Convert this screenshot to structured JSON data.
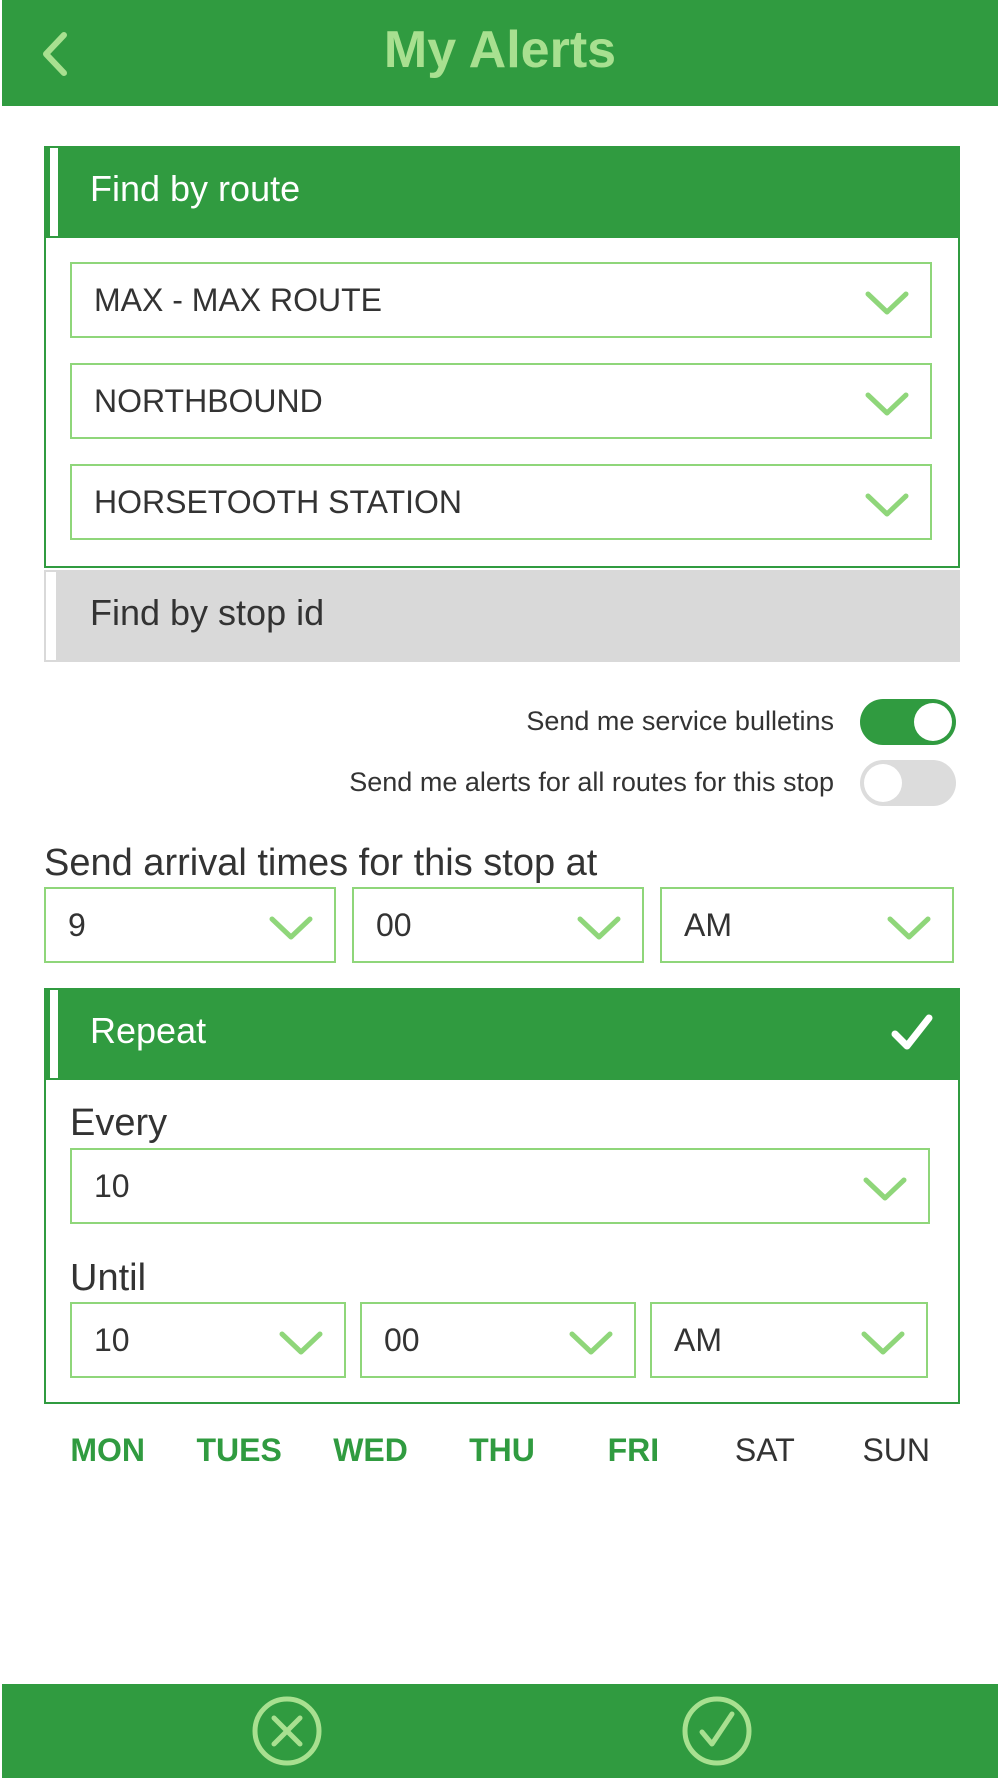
{
  "header": {
    "title": "My Alerts",
    "back_icon": "chevron-left-icon"
  },
  "route_panel": {
    "title": "Find by route",
    "route": "MAX - MAX ROUTE",
    "direction": "NORTHBOUND",
    "stop": "HORSETOOTH STATION"
  },
  "stop_id_panel": {
    "title": "Find by stop id"
  },
  "toggles": {
    "service_bulletins": {
      "label": "Send me service bulletins",
      "state": "on"
    },
    "all_routes": {
      "label": "Send me alerts for all routes for this stop",
      "state": "off"
    }
  },
  "arrival": {
    "label": "Send arrival times for this stop at",
    "hour": "9",
    "minute": "00",
    "ampm": "AM"
  },
  "repeat": {
    "title": "Repeat",
    "checked": true,
    "every_label": "Every",
    "every_value": "10",
    "until_label": "Until",
    "until_hour": "10",
    "until_minute": "00",
    "until_ampm": "AM"
  },
  "days": [
    {
      "label": "MON",
      "active": true
    },
    {
      "label": "TUES",
      "active": true
    },
    {
      "label": "WED",
      "active": true
    },
    {
      "label": "THU",
      "active": true
    },
    {
      "label": "FRI",
      "active": true
    },
    {
      "label": "SAT",
      "active": false
    },
    {
      "label": "SUN",
      "active": false
    }
  ],
  "footer": {
    "cancel_icon": "cancel-circle-icon",
    "confirm_icon": "check-circle-icon"
  },
  "colors": {
    "brand_green": "#309b40",
    "light_green": "#8fd67a",
    "title_green": "#a8e090",
    "gray_panel": "#d9d9d9"
  }
}
